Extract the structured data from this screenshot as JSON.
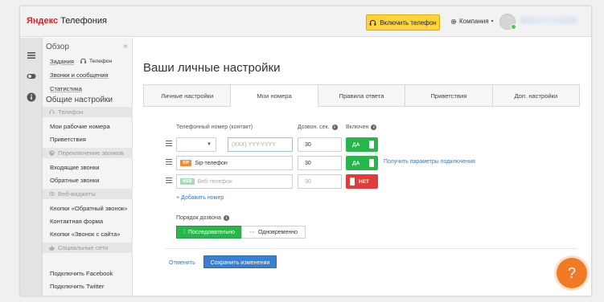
{
  "header": {
    "logo_brand": "Яндекс",
    "logo_product": "Телефония",
    "enable_phone_label": "Включить телефон",
    "company_label": "Компания"
  },
  "sidebar": {
    "overview_label": "Обзор",
    "tasks_label": "Задания",
    "phone_label": "Телефон",
    "calls_label": "Звонки и сообщения",
    "stats_label": "Статистика",
    "general_settings_label": "Общие настройки",
    "group_phone": "Телефон",
    "my_numbers": "Мои рабочие номера",
    "greetings": "Приветствия",
    "group_switch": "Переключение звонков",
    "incoming": "Входящие звонки",
    "callbacks": "Обратные звонки",
    "group_widgets": "Веб-виджеты",
    "callback_buttons": "Кнопки «Обратный звонок»",
    "contact_form": "Контактная форма",
    "call_from_site": "Кнопки «Звонок с сайта»",
    "group_social": "Социальные сети",
    "connect_facebook": "Подключить Facebook",
    "connect_twitter": "Подключить Twitter"
  },
  "main": {
    "title": "Ваши личные настройки",
    "tabs": [
      {
        "label": "Личные настройки"
      },
      {
        "label": "Мои номера"
      },
      {
        "label": "Правила ответа"
      },
      {
        "label": "Приветствия"
      },
      {
        "label": "Доп. настройки"
      }
    ],
    "col_phone": "Телефонный номер (контакт)",
    "col_delay": "Дозвон. сек.",
    "col_enabled": "Включен",
    "rows": [
      {
        "placeholder": "(XXX) YYY-YYYY",
        "delay": "30",
        "state": "ДА"
      },
      {
        "tag": "SIP",
        "name": "Sip-телефон",
        "delay": "30",
        "state": "ДА",
        "link": "Получить параметры подключения"
      },
      {
        "tag": "WEB",
        "name": "Веб-телефон",
        "delay": "30",
        "state": "НЕТ"
      }
    ],
    "add_number": "+ Добавить номер",
    "order_label": "Порядок дозвона",
    "order_sequential": "Последовательно",
    "order_simultaneous": "Одновременно",
    "cancel": "Отменить",
    "save": "Сохранить изменения"
  },
  "help_label": "?",
  "colors": {
    "accent_green": "#27b64a",
    "accent_red": "#df3c3c",
    "accent_blue": "#3b7fd0",
    "yellow_button": "#ffd43a",
    "help_orange": "#f07a25"
  }
}
